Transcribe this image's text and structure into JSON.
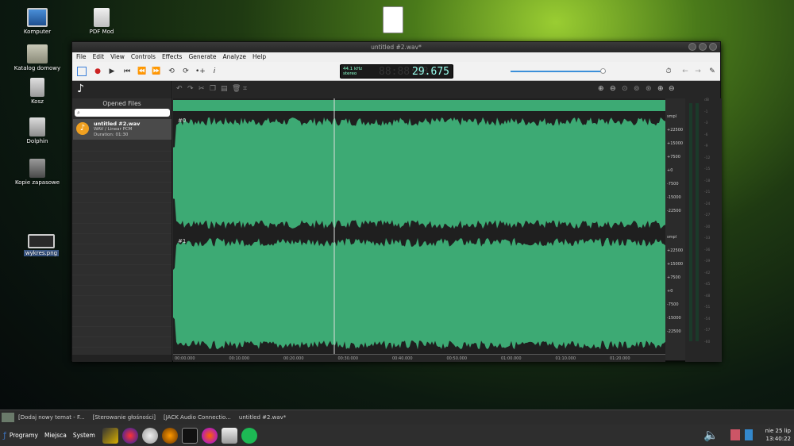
{
  "desktop": {
    "icons": [
      {
        "label": "Komputer"
      },
      {
        "label": "PDF Mod"
      },
      {
        "label": "Katalog domowy"
      },
      {
        "label": "Kosz"
      },
      {
        "label": "Dolphin"
      },
      {
        "label": "Kopie zapasowe"
      },
      {
        "label": "wykres.png"
      }
    ]
  },
  "window": {
    "title": "untitled #2.wav*",
    "menu": [
      "File",
      "Edit",
      "View",
      "Controls",
      "Effects",
      "Generate",
      "Analyze",
      "Help"
    ],
    "display": {
      "sample_rate": "44.1 kHz",
      "channels": "stereo",
      "time": "29.675",
      "ghost": "88:88:88."
    },
    "volume": 0.97
  },
  "sidebar": {
    "title": "Opened Files",
    "file": {
      "name": "untitled #2.wav",
      "type": "WAV / Linear PCM",
      "duration": "Duration: 01:30"
    }
  },
  "waveform": {
    "channels": [
      {
        "label": "#0"
      },
      {
        "label": "#1"
      }
    ],
    "color": "#3daa74",
    "scale_labels": [
      "smpl",
      "+22500",
      "+15000",
      "+7500",
      "+0",
      "-7500",
      "-15000",
      "-22500"
    ],
    "timeline_labels": [
      "00:00.000",
      "00:10.000",
      "00:20.000",
      "00:30.000",
      "00:40.000",
      "00:50.000",
      "01:00.000",
      "01:10.000",
      "01:20.000"
    ],
    "db_labels": [
      "dB",
      "-1",
      "-3",
      "-6",
      "-9",
      "-12",
      "-15",
      "-18",
      "-21",
      "-24",
      "-27",
      "-30",
      "-33",
      "-36",
      "-39",
      "-42",
      "-45",
      "-48",
      "-51",
      "-54",
      "-57",
      "-60"
    ]
  },
  "taskbar": {
    "tasks": [
      "[Dodaj nowy temat - F...",
      "[Sterowanie głośności]",
      "[JACK Audio Connectio...",
      "untitled #2.wav*"
    ]
  },
  "panel": {
    "menus": [
      "Programy",
      "Miejsca",
      "System"
    ],
    "clock_date": "nie 25 lip",
    "clock_time": "13:40:22"
  }
}
